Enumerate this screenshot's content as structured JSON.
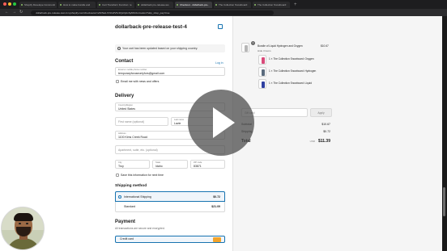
{
  "browser": {
    "tabs": [
      "Shopify Develope Communit",
      "How to make bundle and",
      "Cart Transform Function: re",
      "dollarback pre-release-tes",
      "Checkout - dollarback-pre-",
      "The Collection Snowboard:",
      "The Collection Snowboard:"
    ],
    "active_tab_index": 4,
    "new_tab": "+",
    "url": "dollarback-pre-release-test-4.myshopify.com/checkouts/cn/Z2NwLXVzLWVhc3QxOjAxSjA5/information?skip_shop_pay=true"
  },
  "header": {
    "store_name": "dollarback-pre-release-test-4"
  },
  "notice": {
    "text": "Your cart has been updated based on your shipping country."
  },
  "contact": {
    "heading": "Contact",
    "login_link": "Log in",
    "email_label": "Email or mobile phone number",
    "email_value": "temporaryforuseonlyfors@gmail.com",
    "newsletter_label": "Email me with news and offers"
  },
  "delivery": {
    "heading": "Delivery",
    "country_label": "Country/Region",
    "country_value": "United States",
    "first_name_placeholder": "First name (optional)",
    "last_name_label": "Last name",
    "last_name_value": "Lavie",
    "address_label": "Address",
    "address_value": "1100 Kims Creek Road",
    "apartment_placeholder": "Apartment, suite, etc. (optional)",
    "city_label": "City",
    "city_value": "Troy",
    "state_label": "State",
    "state_value": "Idaho",
    "zip_label": "ZIP code",
    "zip_value": "83871",
    "save_info_label": "Save this information for next time"
  },
  "shipping": {
    "heading": "Shipping method",
    "options": [
      {
        "name": "International Shipping",
        "price": "$0.72"
      },
      {
        "name": "Standard",
        "price": "$21.09"
      }
    ]
  },
  "payment": {
    "heading": "Payment",
    "subtext": "All transactions are secure and encrypted.",
    "method": "Credit card"
  },
  "summary": {
    "items": [
      {
        "title": "Bundle of Liquid Hydrogen and Oxygen",
        "qty": "1",
        "price": "$10.67",
        "sub": "Hide 3 items"
      }
    ],
    "subitems": [
      {
        "text": "1 × The Collection Snowboard: Oxygen",
        "color": "#d94b7a"
      },
      {
        "text": "1 × The Collection Snowboard: Hydrogen",
        "color": "#5a6b7d"
      },
      {
        "text": "1 × The Collection Snowboard: Liquid",
        "color": "#2e3fa0"
      }
    ],
    "discount_placeholder": "Gift card",
    "apply_label": "Apply",
    "subtotal_label": "Subtotal",
    "subtotal_value": "$10.67",
    "shipping_label": "Shipping",
    "shipping_value": "$0.72",
    "total_label": "Total",
    "currency": "USD",
    "total_value": "$11.39"
  },
  "colors": {
    "accent": "#1773b0",
    "credit_card_badge": "#f2a32a"
  }
}
